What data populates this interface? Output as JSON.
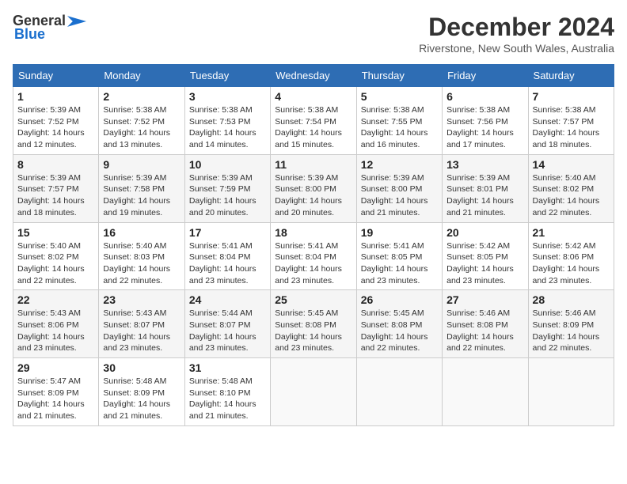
{
  "logo": {
    "general": "General",
    "blue": "Blue"
  },
  "title": "December 2024",
  "subtitle": "Riverstone, New South Wales, Australia",
  "headers": [
    "Sunday",
    "Monday",
    "Tuesday",
    "Wednesday",
    "Thursday",
    "Friday",
    "Saturday"
  ],
  "weeks": [
    [
      {
        "day": "1",
        "sunrise": "Sunrise: 5:39 AM",
        "sunset": "Sunset: 7:52 PM",
        "daylight": "Daylight: 14 hours and 12 minutes."
      },
      {
        "day": "2",
        "sunrise": "Sunrise: 5:38 AM",
        "sunset": "Sunset: 7:52 PM",
        "daylight": "Daylight: 14 hours and 13 minutes."
      },
      {
        "day": "3",
        "sunrise": "Sunrise: 5:38 AM",
        "sunset": "Sunset: 7:53 PM",
        "daylight": "Daylight: 14 hours and 14 minutes."
      },
      {
        "day": "4",
        "sunrise": "Sunrise: 5:38 AM",
        "sunset": "Sunset: 7:54 PM",
        "daylight": "Daylight: 14 hours and 15 minutes."
      },
      {
        "day": "5",
        "sunrise": "Sunrise: 5:38 AM",
        "sunset": "Sunset: 7:55 PM",
        "daylight": "Daylight: 14 hours and 16 minutes."
      },
      {
        "day": "6",
        "sunrise": "Sunrise: 5:38 AM",
        "sunset": "Sunset: 7:56 PM",
        "daylight": "Daylight: 14 hours and 17 minutes."
      },
      {
        "day": "7",
        "sunrise": "Sunrise: 5:38 AM",
        "sunset": "Sunset: 7:57 PM",
        "daylight": "Daylight: 14 hours and 18 minutes."
      }
    ],
    [
      {
        "day": "8",
        "sunrise": "Sunrise: 5:39 AM",
        "sunset": "Sunset: 7:57 PM",
        "daylight": "Daylight: 14 hours and 18 minutes."
      },
      {
        "day": "9",
        "sunrise": "Sunrise: 5:39 AM",
        "sunset": "Sunset: 7:58 PM",
        "daylight": "Daylight: 14 hours and 19 minutes."
      },
      {
        "day": "10",
        "sunrise": "Sunrise: 5:39 AM",
        "sunset": "Sunset: 7:59 PM",
        "daylight": "Daylight: 14 hours and 20 minutes."
      },
      {
        "day": "11",
        "sunrise": "Sunrise: 5:39 AM",
        "sunset": "Sunset: 8:00 PM",
        "daylight": "Daylight: 14 hours and 20 minutes."
      },
      {
        "day": "12",
        "sunrise": "Sunrise: 5:39 AM",
        "sunset": "Sunset: 8:00 PM",
        "daylight": "Daylight: 14 hours and 21 minutes."
      },
      {
        "day": "13",
        "sunrise": "Sunrise: 5:39 AM",
        "sunset": "Sunset: 8:01 PM",
        "daylight": "Daylight: 14 hours and 21 minutes."
      },
      {
        "day": "14",
        "sunrise": "Sunrise: 5:40 AM",
        "sunset": "Sunset: 8:02 PM",
        "daylight": "Daylight: 14 hours and 22 minutes."
      }
    ],
    [
      {
        "day": "15",
        "sunrise": "Sunrise: 5:40 AM",
        "sunset": "Sunset: 8:02 PM",
        "daylight": "Daylight: 14 hours and 22 minutes."
      },
      {
        "day": "16",
        "sunrise": "Sunrise: 5:40 AM",
        "sunset": "Sunset: 8:03 PM",
        "daylight": "Daylight: 14 hours and 22 minutes."
      },
      {
        "day": "17",
        "sunrise": "Sunrise: 5:41 AM",
        "sunset": "Sunset: 8:04 PM",
        "daylight": "Daylight: 14 hours and 23 minutes."
      },
      {
        "day": "18",
        "sunrise": "Sunrise: 5:41 AM",
        "sunset": "Sunset: 8:04 PM",
        "daylight": "Daylight: 14 hours and 23 minutes."
      },
      {
        "day": "19",
        "sunrise": "Sunrise: 5:41 AM",
        "sunset": "Sunset: 8:05 PM",
        "daylight": "Daylight: 14 hours and 23 minutes."
      },
      {
        "day": "20",
        "sunrise": "Sunrise: 5:42 AM",
        "sunset": "Sunset: 8:05 PM",
        "daylight": "Daylight: 14 hours and 23 minutes."
      },
      {
        "day": "21",
        "sunrise": "Sunrise: 5:42 AM",
        "sunset": "Sunset: 8:06 PM",
        "daylight": "Daylight: 14 hours and 23 minutes."
      }
    ],
    [
      {
        "day": "22",
        "sunrise": "Sunrise: 5:43 AM",
        "sunset": "Sunset: 8:06 PM",
        "daylight": "Daylight: 14 hours and 23 minutes."
      },
      {
        "day": "23",
        "sunrise": "Sunrise: 5:43 AM",
        "sunset": "Sunset: 8:07 PM",
        "daylight": "Daylight: 14 hours and 23 minutes."
      },
      {
        "day": "24",
        "sunrise": "Sunrise: 5:44 AM",
        "sunset": "Sunset: 8:07 PM",
        "daylight": "Daylight: 14 hours and 23 minutes."
      },
      {
        "day": "25",
        "sunrise": "Sunrise: 5:45 AM",
        "sunset": "Sunset: 8:08 PM",
        "daylight": "Daylight: 14 hours and 23 minutes."
      },
      {
        "day": "26",
        "sunrise": "Sunrise: 5:45 AM",
        "sunset": "Sunset: 8:08 PM",
        "daylight": "Daylight: 14 hours and 22 minutes."
      },
      {
        "day": "27",
        "sunrise": "Sunrise: 5:46 AM",
        "sunset": "Sunset: 8:08 PM",
        "daylight": "Daylight: 14 hours and 22 minutes."
      },
      {
        "day": "28",
        "sunrise": "Sunrise: 5:46 AM",
        "sunset": "Sunset: 8:09 PM",
        "daylight": "Daylight: 14 hours and 22 minutes."
      }
    ],
    [
      {
        "day": "29",
        "sunrise": "Sunrise: 5:47 AM",
        "sunset": "Sunset: 8:09 PM",
        "daylight": "Daylight: 14 hours and 21 minutes."
      },
      {
        "day": "30",
        "sunrise": "Sunrise: 5:48 AM",
        "sunset": "Sunset: 8:09 PM",
        "daylight": "Daylight: 14 hours and 21 minutes."
      },
      {
        "day": "31",
        "sunrise": "Sunrise: 5:48 AM",
        "sunset": "Sunset: 8:10 PM",
        "daylight": "Daylight: 14 hours and 21 minutes."
      },
      null,
      null,
      null,
      null
    ]
  ]
}
